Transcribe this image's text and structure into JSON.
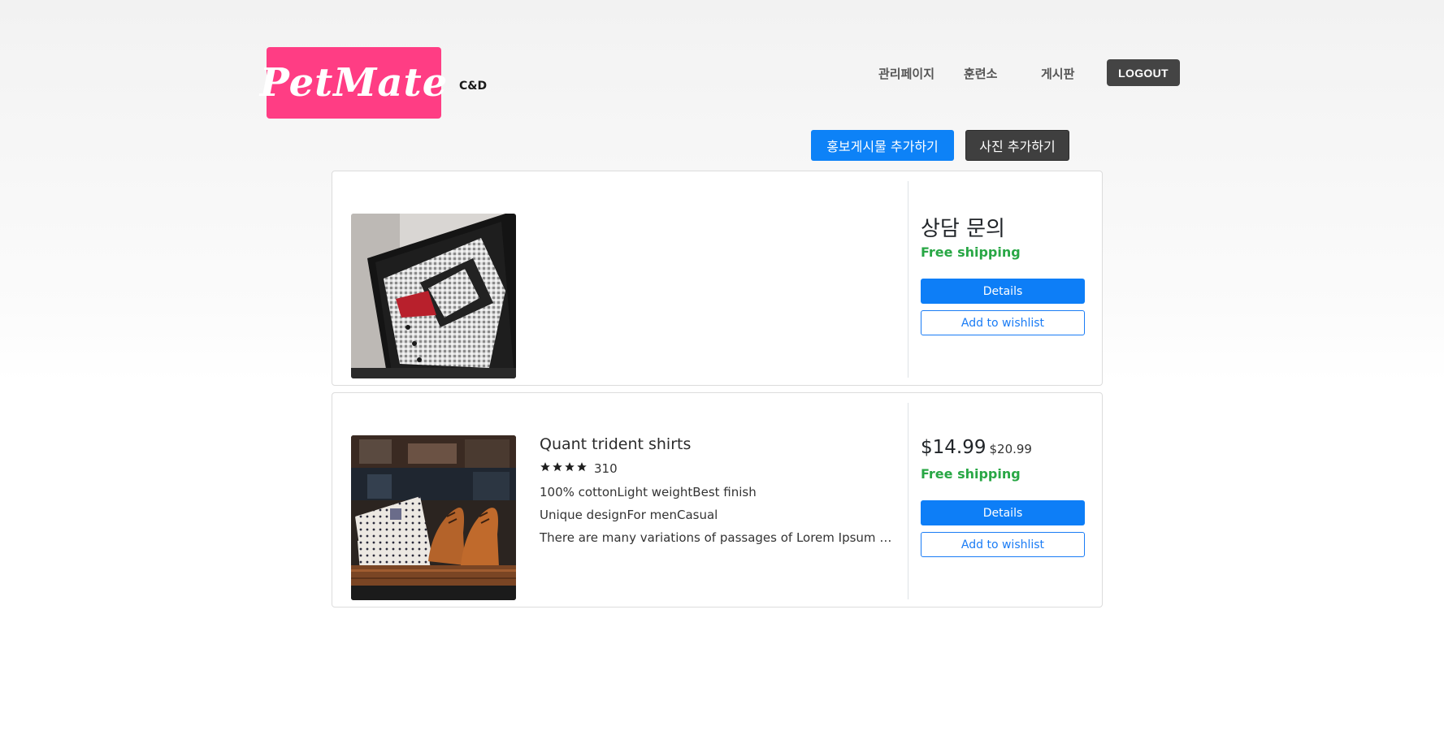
{
  "header": {
    "logo_text": "PetMate",
    "brand_sub": "C&D",
    "nav": [
      "관리페이지",
      "훈련소",
      "게시판"
    ],
    "logout_label": "LOGOUT"
  },
  "actions": {
    "add_promo_label": "홍보게시물 추가하기",
    "add_photo_label": "사진 추가하기"
  },
  "products": [
    {
      "image": "dress-shirt-in-box",
      "title": "상담 문의",
      "shipping": "Free shipping",
      "details_label": "Details",
      "wishlist_label": "Add to wishlist"
    },
    {
      "image": "shirts-and-leather-shoes",
      "name": "Quant trident shirts",
      "rating_stars": 4,
      "review_count": "310",
      "features_line1": "100% cottonLight weightBest finish",
      "features_line2": "Unique designFor menCasual",
      "description": "There are many variations of passages of Lorem Ipsum available, but the majority have suffered alteration in some form, by injected humour, or randomised words which don't look even slightly believable.",
      "price": "$14.99",
      "old_price": "$20.99",
      "shipping": "Free shipping",
      "details_label": "Details",
      "wishlist_label": "Add to wishlist"
    }
  ],
  "colors": {
    "logo_bg": "#ff3d84",
    "primary": "#0d82f7",
    "dark": "#444444",
    "success": "#28a745"
  }
}
